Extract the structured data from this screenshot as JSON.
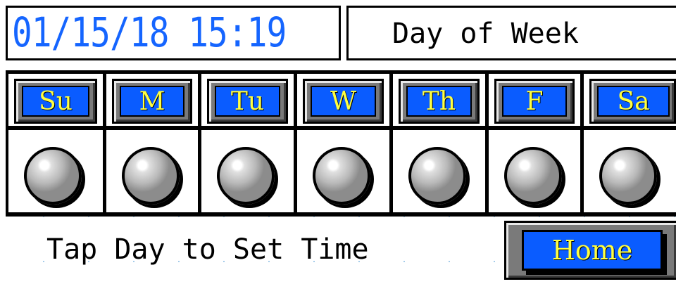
{
  "header": {
    "datetime": "01/15/18 15:19",
    "title": "Day of Week"
  },
  "days": [
    {
      "label": "Su",
      "indicator_on": false
    },
    {
      "label": "M",
      "indicator_on": false
    },
    {
      "label": "Tu",
      "indicator_on": false
    },
    {
      "label": "W",
      "indicator_on": false
    },
    {
      "label": "Th",
      "indicator_on": false
    },
    {
      "label": "F",
      "indicator_on": false
    },
    {
      "label": "Sa",
      "indicator_on": false
    }
  ],
  "footer": {
    "hint": "Tap Day to Set Time",
    "home_label": "Home"
  },
  "colors": {
    "button_face": "#0a5cff",
    "button_text": "#ffff40",
    "clock_text": "#1565ff",
    "indicator_off": "#b8b8b8"
  },
  "icons": {
    "indicator": "round-indicator-lamp-icon"
  }
}
